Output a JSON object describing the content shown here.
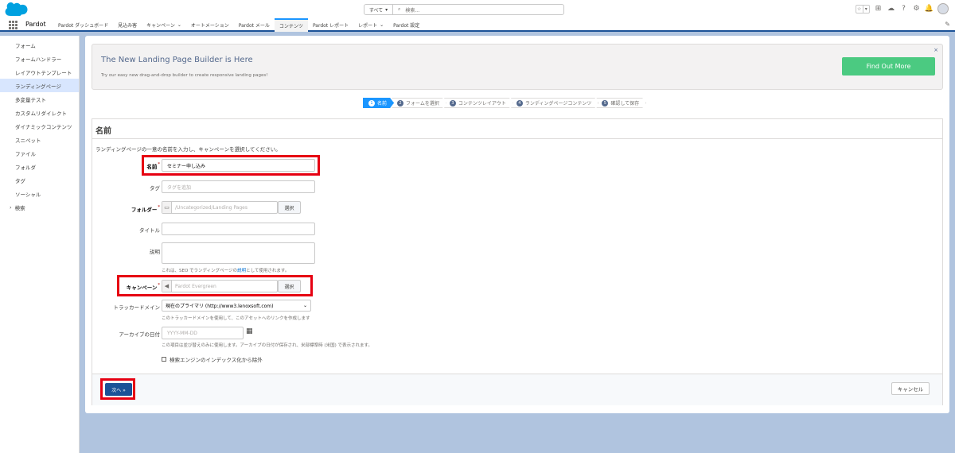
{
  "header": {
    "search_scope": "すべて",
    "search_placeholder": "検索..."
  },
  "nav": {
    "app_name": "Pardot",
    "items": [
      {
        "label": "Pardot ダッシュボード",
        "dropdown": false
      },
      {
        "label": "見込み客",
        "dropdown": false
      },
      {
        "label": "キャンペーン",
        "dropdown": true
      },
      {
        "label": "オートメーション",
        "dropdown": false
      },
      {
        "label": "Pardot メール",
        "dropdown": false
      },
      {
        "label": "コンテンツ",
        "dropdown": false,
        "active": true
      },
      {
        "label": "Pardot レポート",
        "dropdown": false
      },
      {
        "label": "レポート",
        "dropdown": true
      },
      {
        "label": "Pardot 設定",
        "dropdown": false
      }
    ]
  },
  "sidebar": {
    "items": [
      "フォーム",
      "フォームハンドラー",
      "レイアウトテンプレート",
      "ランディングページ",
      "多変量テスト",
      "カスタムリダイレクト",
      "ダイナミックコンテンツ",
      "スニペット",
      "ファイル",
      "フォルダ",
      "タグ",
      "ソーシャル",
      "検索"
    ],
    "active_index": 3
  },
  "banner": {
    "title": "The New Landing Page Builder is Here",
    "subtitle": "Try our easy new drag-and-drop builder to create responsive landing pages!",
    "button": "Find Out More",
    "close": "×"
  },
  "steps": [
    {
      "num": "1",
      "label": "名前"
    },
    {
      "num": "2",
      "label": "フォームを選択"
    },
    {
      "num": "3",
      "label": "コンテンツレイアウト"
    },
    {
      "num": "4",
      "label": "ランディングページコンテンツ"
    },
    {
      "num": "5",
      "label": "確認して保存"
    }
  ],
  "form": {
    "section_title": "名前",
    "description": "ランディングページの一意の名前を入力し、キャンペーンを選択してください。",
    "name_label": "名前",
    "name_value": "セミナー申し込み",
    "tag_label": "タグ",
    "tag_placeholder": "タグを追加",
    "folder_label": "フォルダー",
    "folder_value": "/Uncategorized/Landing Pages",
    "select_button": "選択",
    "title_label": "タイトル",
    "desc_label": "説明",
    "desc_help_pre": "これは、SEO でランディングページの",
    "desc_help_link": "説明",
    "desc_help_post": "として使用されます。",
    "campaign_label": "キャンペーン",
    "campaign_value": "Pardot Evergreen",
    "tracker_label": "トラッカードメイン",
    "tracker_value": "現在のプライマリ (http://www3.lenoxsoft.com)",
    "tracker_help": "このトラッカードメインを使用して、このアセットへのリンクを作成します",
    "archive_label": "アーカイブの日付",
    "archive_placeholder": "YYYY-MM-DD",
    "archive_help": "この項目は並び替えのみに使用します。アーカイブの日付が保存され、米部標準時 (米国) で表示されます。",
    "seo_checkbox": "検索エンジンのインデックス化から除外",
    "next_button": "次へ »",
    "cancel_button": "キャンセル",
    "required_mark": "*"
  },
  "colors": {
    "accent": "#1b96ff",
    "banner_button": "#4bca81",
    "highlight": "#e60012",
    "primary_button": "#1b5297"
  }
}
